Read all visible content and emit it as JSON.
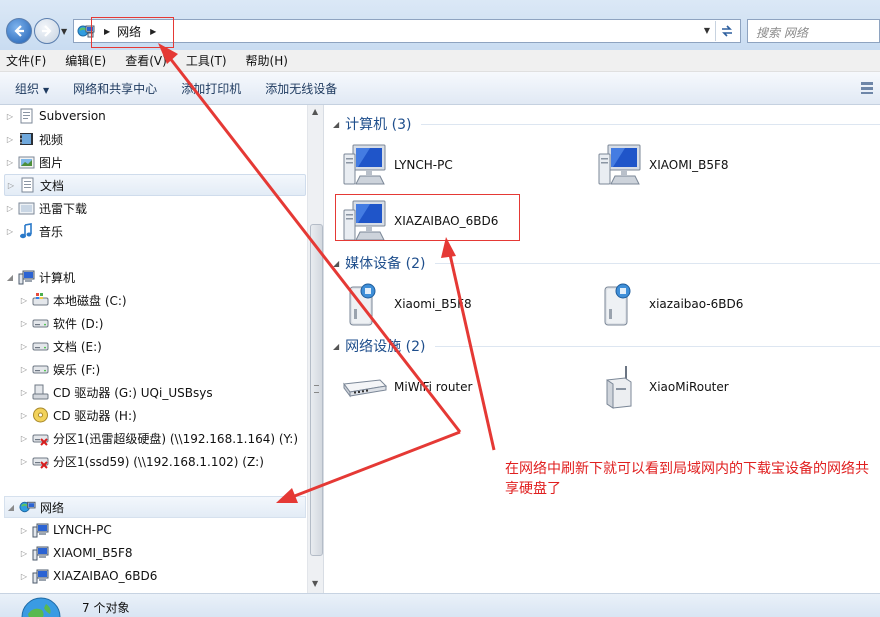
{
  "address_bar": {
    "crumb": "网络",
    "search_placeholder": "搜索 网络"
  },
  "menu": [
    "文件(F)",
    "编辑(E)",
    "查看(V)",
    "工具(T)",
    "帮助(H)"
  ],
  "toolbar": {
    "organize": "组织",
    "network_center": "网络和共享中心",
    "add_printer": "添加打印机",
    "add_wireless": "添加无线设备"
  },
  "nav": {
    "libraries": [
      {
        "label": "Subversion",
        "icon": "subversion-icon"
      },
      {
        "label": "视频",
        "icon": "video-icon"
      },
      {
        "label": "图片",
        "icon": "pictures-icon"
      },
      {
        "label": "文档",
        "icon": "documents-icon"
      },
      {
        "label": "迅雷下载",
        "icon": "download-folder-icon"
      },
      {
        "label": "音乐",
        "icon": "music-icon"
      }
    ],
    "computer": {
      "label": "计算机",
      "drives": [
        "本地磁盘 (C:)",
        "软件 (D:)",
        "文档 (E:)",
        "娱乐 (F:)",
        "CD 驱动器 (G:) UQi_USBsys",
        "CD 驱动器 (H:)",
        "分区1(迅雷超级硬盘) (\\\\192.168.1.164) (Y:)",
        "分区1(ssd59) (\\\\192.168.1.102) (Z:)"
      ]
    },
    "network": {
      "label": "网络",
      "items": [
        "LYNCH-PC",
        "XIAOMI_B5F8",
        "XIAZAIBAO_6BD6"
      ]
    }
  },
  "content": {
    "groups": [
      {
        "title": "计算机 (3)",
        "items": [
          "LYNCH-PC",
          "XIAOMI_B5F8",
          "XIAZAIBAO_6BD6"
        ]
      },
      {
        "title": "媒体设备 (2)",
        "items": [
          "Xiaomi_B5F8",
          "xiazaibao-6BD6"
        ]
      },
      {
        "title": "网络设施 (2)",
        "items": [
          "MiWiFi router",
          "XiaoMiRouter"
        ]
      }
    ]
  },
  "status": {
    "text": "7 个对象"
  },
  "annotation": {
    "note": "在网络中刷新下就可以看到局域网内的下载宝设备的网络共享硬盘了",
    "color": "#e53935"
  }
}
